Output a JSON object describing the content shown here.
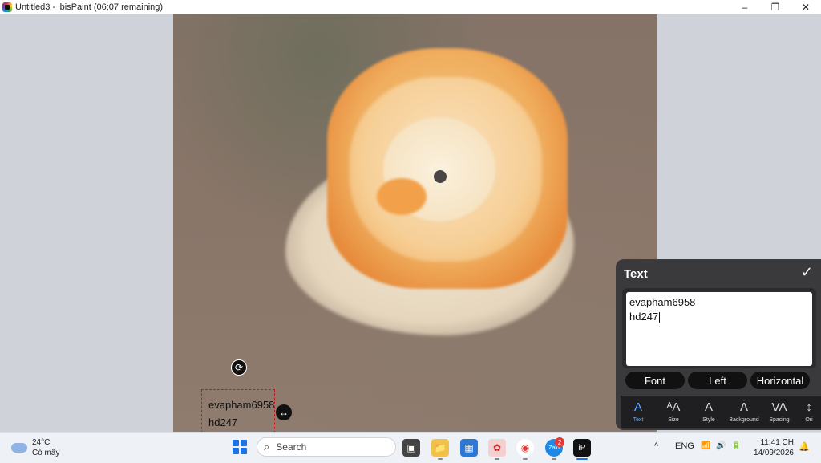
{
  "titlebar": {
    "title": "Untitled3 - ibisPaint (06:07 remaining)"
  },
  "window_controls": {
    "minimize": "–",
    "maximize": "❐",
    "close": "✕"
  },
  "canvas": {
    "handles": {
      "rotate": "⟳",
      "resize": "↔"
    },
    "text_object": {
      "line1": "evapham6958",
      "line2": "hd247"
    }
  },
  "text_panel": {
    "title": "Text",
    "confirm_icon": "✓",
    "content_line1": "evapham6958",
    "content_line2": "hd247",
    "buttons": {
      "font": "Font",
      "align": "Left",
      "direction": "Horizontal"
    },
    "tools": [
      {
        "label": "Text",
        "icon": "A"
      },
      {
        "label": "Size",
        "icon": "ᴬA"
      },
      {
        "label": "Style",
        "icon": "A"
      },
      {
        "label": "Background",
        "icon": "A"
      },
      {
        "label": "Spacing",
        "icon": "VA"
      },
      {
        "label": "Ori",
        "icon": "↕"
      }
    ]
  },
  "taskbar": {
    "weather": {
      "temp": "24°C",
      "condition": "Có mây"
    },
    "search": {
      "placeholder": "Search"
    },
    "apps": [
      {
        "name": "task-view",
        "icon": "▣"
      },
      {
        "name": "file-explorer",
        "icon": "📁"
      },
      {
        "name": "store",
        "icon": "▦"
      },
      {
        "name": "app-red",
        "icon": "✿"
      },
      {
        "name": "chrome",
        "icon": "◉"
      },
      {
        "name": "zalo",
        "icon": "Zalo"
      },
      {
        "name": "ibispaint",
        "icon": "iP"
      }
    ],
    "notification_badge": "2",
    "tray": {
      "chevron": "^",
      "lang": "ENG",
      "wifi": "📶",
      "volume": "🔊",
      "battery": "🔋"
    },
    "clock": {
      "time": "11:41 CH",
      "date": "14/09/2026"
    },
    "notifications_icon": "🔔"
  }
}
